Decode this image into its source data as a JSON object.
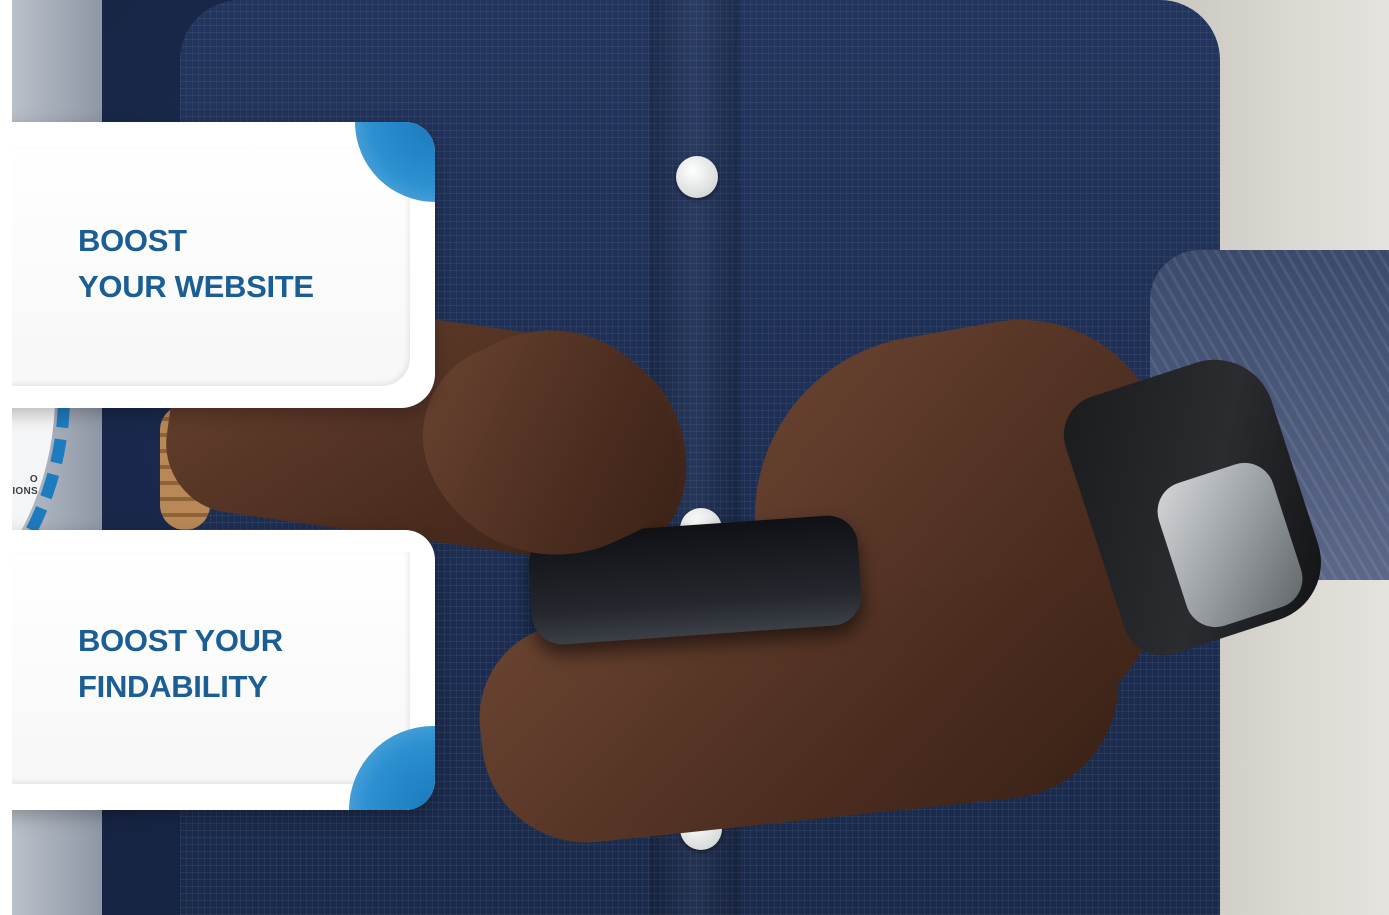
{
  "background_photo": {
    "subject": "person-holding-smartphone"
  },
  "ring": {
    "label_line1": "O",
    "label_line2": "TIONS",
    "color": "#1f7bbf"
  },
  "cards": [
    {
      "title": "BOOST\nYOUR WEBSITE"
    },
    {
      "title": "BOOST YOUR\nFINDABILITY"
    }
  ],
  "colors": {
    "accent": "#1f7bbf",
    "title": "#1b5e95"
  }
}
